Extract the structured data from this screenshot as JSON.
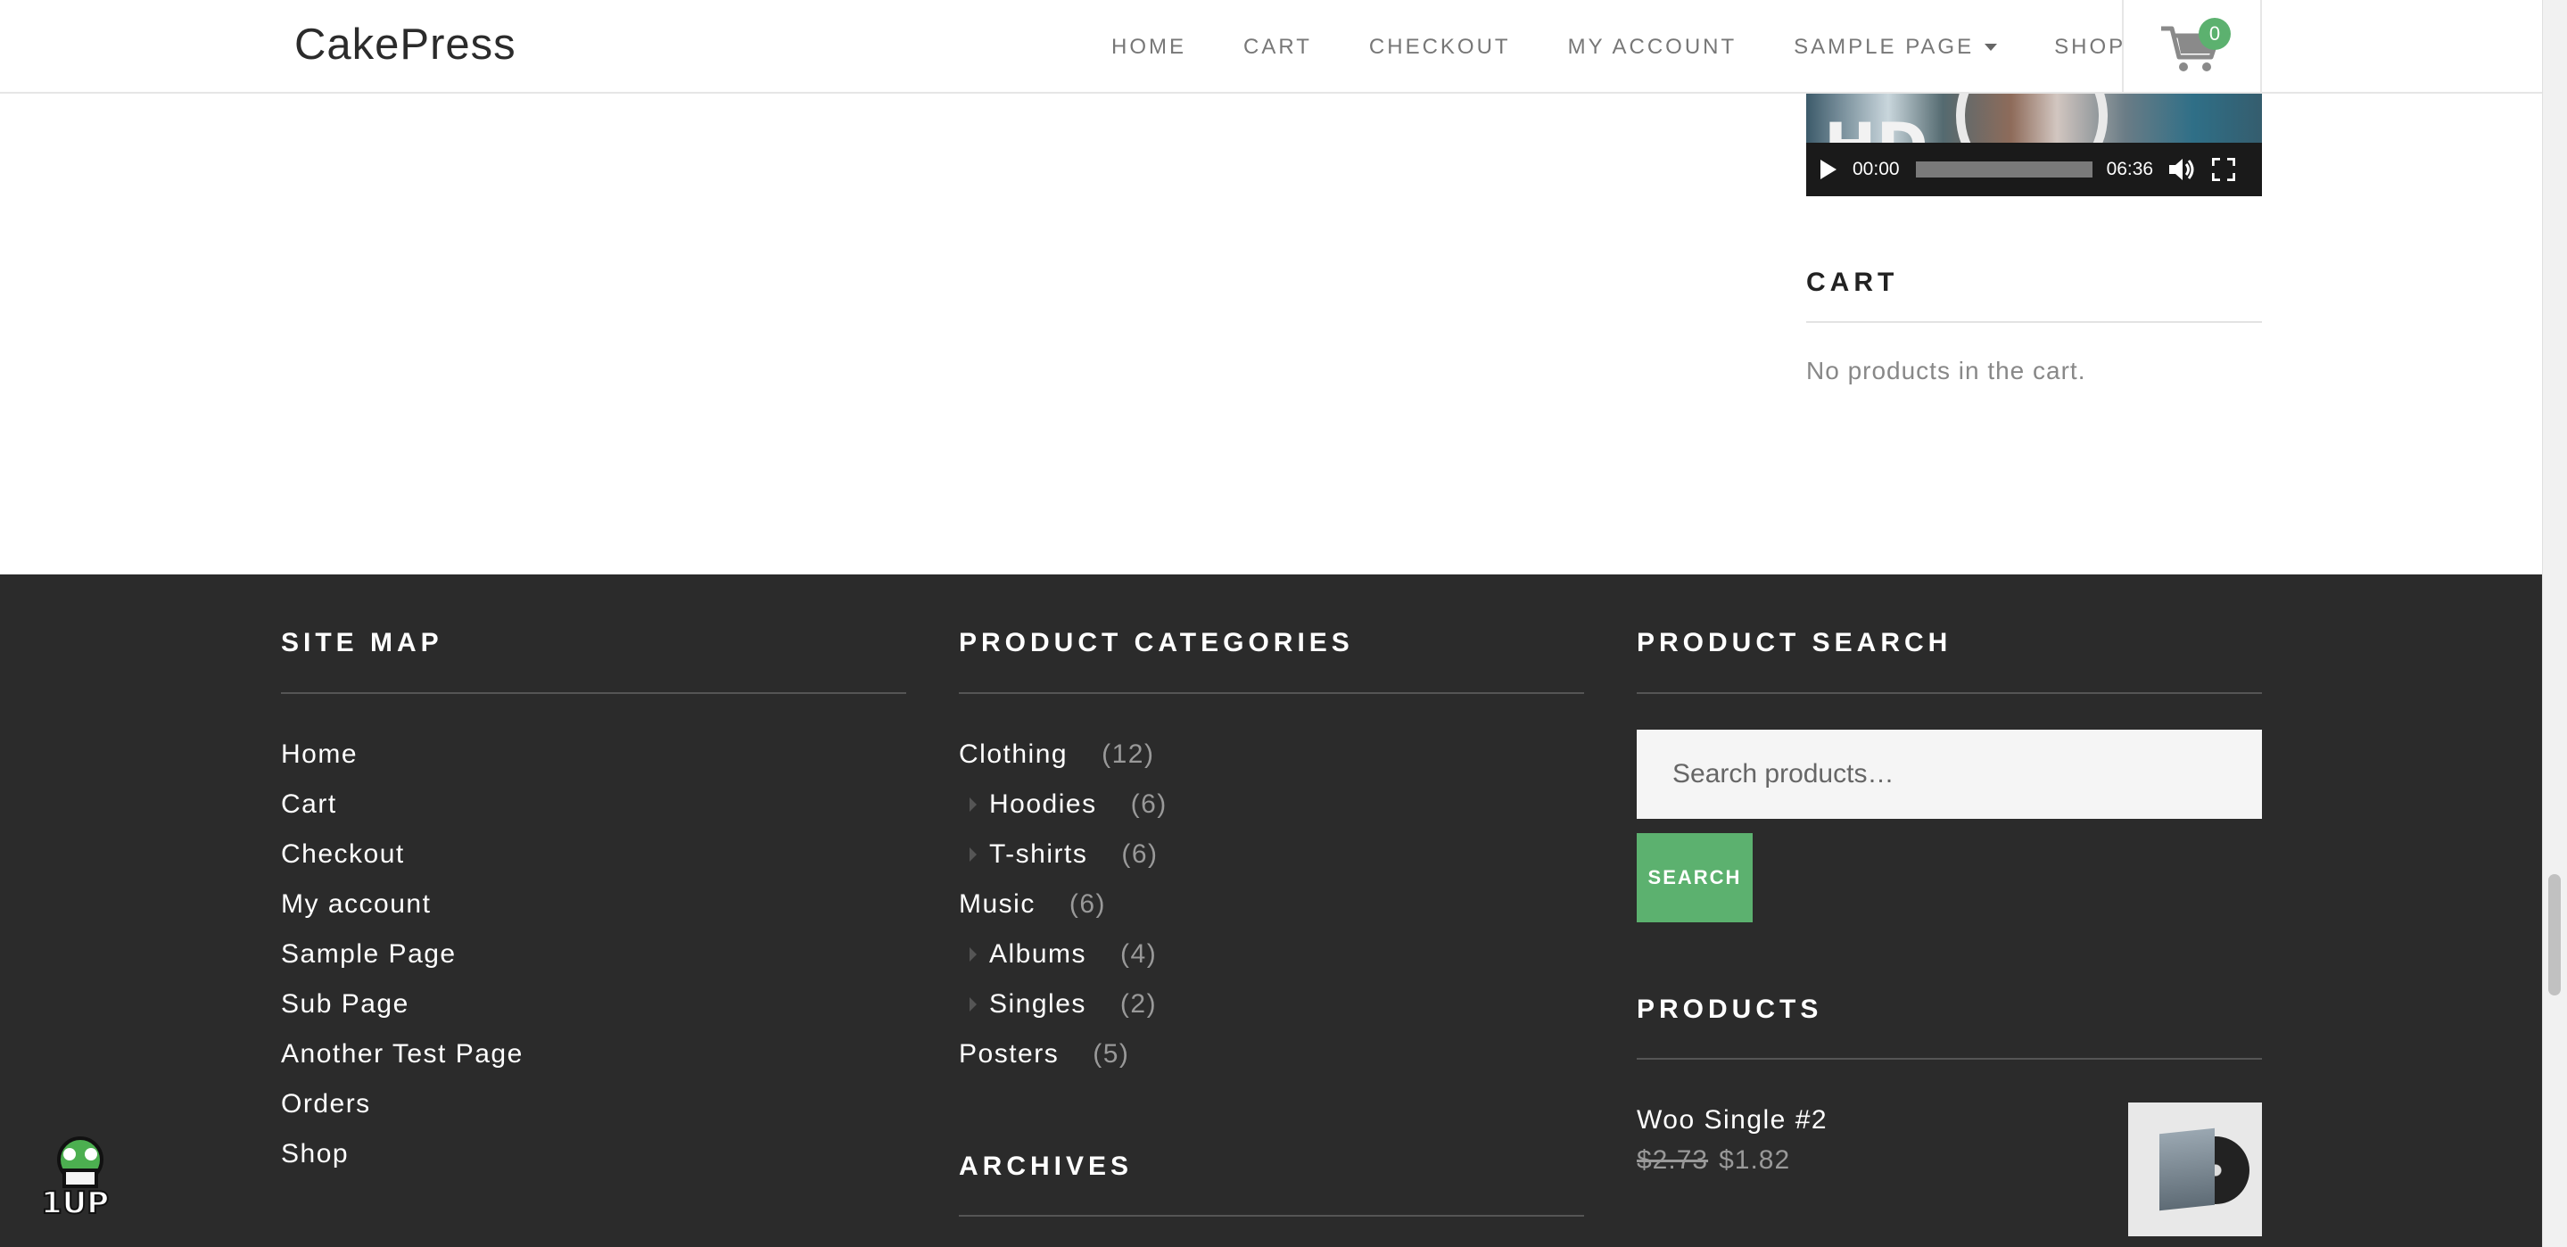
{
  "header": {
    "site_title": "CakePress",
    "nav": [
      {
        "label": "HOME"
      },
      {
        "label": "CART"
      },
      {
        "label": "CHECKOUT"
      },
      {
        "label": "MY ACCOUNT"
      },
      {
        "label": "SAMPLE PAGE",
        "has_dropdown": true
      },
      {
        "label": "SHOP"
      }
    ],
    "cart_count": "0",
    "cart_icon": "cart-icon"
  },
  "sidebar": {
    "video": {
      "overlay_text": "HD",
      "current_time": "00:00",
      "duration": "06:36",
      "progress": 0
    },
    "cart_widget": {
      "title": "CART",
      "empty_message": "No products in the cart."
    }
  },
  "footer": {
    "site_map": {
      "title": "SITE MAP",
      "links": [
        "Home",
        "Cart",
        "Checkout",
        "My account",
        "Sample Page",
        "Sub Page",
        "Another Test Page",
        "Orders",
        "Shop"
      ]
    },
    "product_categories": {
      "title": "PRODUCT CATEGORIES",
      "items": [
        {
          "name": "Clothing",
          "count": "(12)",
          "child": false
        },
        {
          "name": "Hoodies",
          "count": "(6)",
          "child": true
        },
        {
          "name": "T-shirts",
          "count": "(6)",
          "child": true
        },
        {
          "name": "Music",
          "count": "(6)",
          "child": false
        },
        {
          "name": "Albums",
          "count": "(4)",
          "child": true
        },
        {
          "name": "Singles",
          "count": "(2)",
          "child": true
        },
        {
          "name": "Posters",
          "count": "(5)",
          "child": false
        }
      ]
    },
    "archives": {
      "title": "ARCHIVES"
    },
    "product_search": {
      "title": "PRODUCT SEARCH",
      "placeholder": "Search products…",
      "button_label": "SEARCH"
    },
    "products": {
      "title": "PRODUCTS",
      "items": [
        {
          "name": "Woo Single #2",
          "price_old": "$2.73",
          "price_new": "$1.82"
        }
      ]
    }
  },
  "colors": {
    "accent_green": "#5cb16f",
    "footer_bg": "#2b2b2b",
    "nav_text": "#777777"
  }
}
